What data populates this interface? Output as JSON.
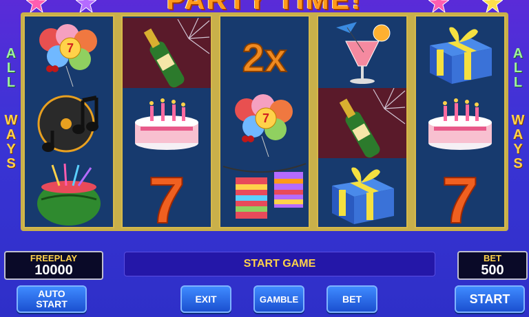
{
  "title": "PARTY TIME!",
  "side_left": [
    "A",
    "L",
    "L",
    "W",
    "A",
    "Y",
    "S"
  ],
  "side_right": [
    "A",
    "L",
    "L",
    "W",
    "A",
    "Y",
    "S"
  ],
  "reels": [
    {
      "symbols": [
        "balloons-icon",
        "music-notes-icon",
        "watermelon-icon"
      ]
    },
    {
      "symbols": [
        "champagne-icon",
        "cake-icon",
        "seven-icon"
      ]
    },
    {
      "symbols": [
        "2x-icon",
        "balloons-icon",
        "bunting-icon"
      ]
    },
    {
      "symbols": [
        "cocktail-icon",
        "champagne-icon",
        "gift-icon"
      ]
    },
    {
      "symbols": [
        "gift-icon",
        "cake-icon",
        "seven-icon"
      ]
    }
  ],
  "multiplier_text": "2x",
  "seven_text": "7",
  "freeplay": {
    "label": "FREEPLAY",
    "value": "10000"
  },
  "bet": {
    "label": "BET",
    "value": "500"
  },
  "status_text": "START GAME",
  "buttons": {
    "auto_start": "AUTO\nSTART",
    "exit": "EXIT",
    "gamble": "GAMBLE",
    "bet": "BET",
    "start": "START"
  },
  "colors": {
    "background": "#3a2fd0",
    "reel_bg": "#173a6e",
    "frame": "#d7b94a",
    "accent": "#ffd24a"
  }
}
